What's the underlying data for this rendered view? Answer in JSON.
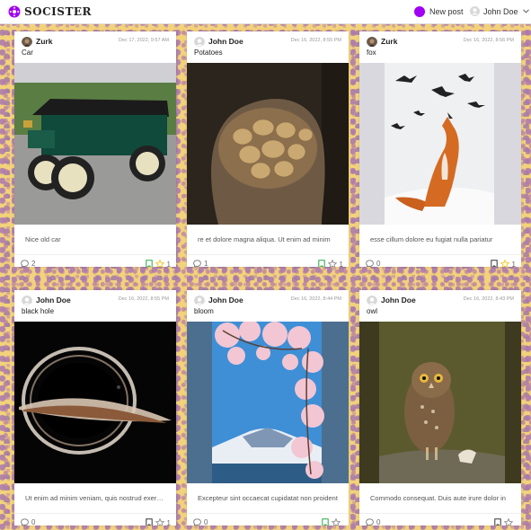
{
  "app": {
    "logo_text": "SOCISTER"
  },
  "header": {
    "new_post_label": "New post",
    "user_name": "John Doe"
  },
  "colors": {
    "accent": "#a100f5",
    "bookmark_active": "#28a745",
    "star_active": "#f5c518"
  },
  "posts": [
    {
      "author": "Zurk",
      "date": "Dec 17, 2022, 9:57 AM",
      "title": "Car",
      "text": "Nice old car",
      "comments": "2",
      "stars": "1",
      "bookmarked": true,
      "starred": true,
      "image": "car"
    },
    {
      "author": "John Doe",
      "date": "Dec 16, 2022, 8:55 PM",
      "title": "Potatoes",
      "text": "re et dolore magna aliqua. Ut enim ad minim",
      "comments": "1",
      "stars": "1",
      "bookmarked": true,
      "starred": false,
      "image": "potatoes"
    },
    {
      "author": "Zurk",
      "date": "Dec 16, 2022, 8:56 PM",
      "title": "fox",
      "text": "esse cillum dolore eu fugiat nulla pariatur",
      "comments": "0",
      "stars": "1",
      "bookmarked": false,
      "starred": true,
      "image": "fox"
    },
    {
      "author": "John Doe",
      "date": "Dec 16, 2022, 8:55 PM",
      "title": "black hole",
      "text": "Ut enim ad minim veniam, quis nostrud exercitation",
      "comments": "0",
      "stars": "1",
      "bookmarked": false,
      "starred": false,
      "image": "blackhole"
    },
    {
      "author": "John Doe",
      "date": "Dec 16, 2022, 8:44 PM",
      "title": "bloom",
      "text": "Excepteur sint occaecat cupidatat non proident",
      "comments": "0",
      "stars": "",
      "bookmarked": true,
      "starred": false,
      "image": "bloom"
    },
    {
      "author": "John Doe",
      "date": "Dec 16, 2022, 8:43 PM",
      "title": "owl",
      "text": "Commodo consequat. Duis aute irure dolor in",
      "comments": "0",
      "stars": "",
      "bookmarked": false,
      "starred": false,
      "image": "owl"
    }
  ]
}
